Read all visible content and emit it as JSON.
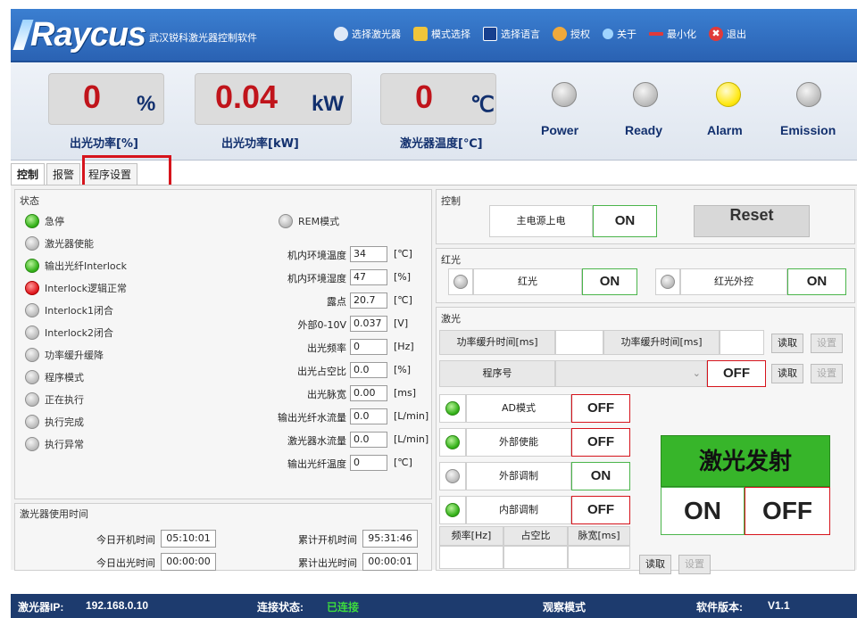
{
  "app": {
    "logo": "Raycus",
    "title": "武汉锐科激光器控制软件",
    "menu": [
      {
        "label": "选择激光器",
        "icon": "laser-select-icon",
        "color": "#ffffff"
      },
      {
        "label": "模式选择",
        "icon": "mode-select-icon",
        "color": "#f0c53b"
      },
      {
        "label": "选择语言",
        "icon": "language-icon",
        "color": "#1e4fa8"
      },
      {
        "label": "授权",
        "icon": "authorize-icon",
        "color": "#f0a93b"
      },
      {
        "label": "关于",
        "icon": "about-icon",
        "color": "#9fd4ff"
      },
      {
        "label": "最小化",
        "icon": "minimize-icon",
        "color": "#e03a3a"
      },
      {
        "label": "退出",
        "icon": "exit-icon",
        "color": "#e03a3a"
      }
    ]
  },
  "readouts": [
    {
      "value": "0",
      "unit": "%",
      "label": "出光功率[%]"
    },
    {
      "value": "0.04",
      "unit": "kW",
      "label": "出光功率[kW]"
    },
    {
      "value": "0",
      "unit": "℃",
      "label": "激光器温度[℃]"
    }
  ],
  "lamps": [
    {
      "label": "Power",
      "on": false
    },
    {
      "label": "Ready",
      "on": false
    },
    {
      "label": "Alarm",
      "on": true
    },
    {
      "label": "Emission",
      "on": false
    }
  ],
  "tabs": [
    "控制",
    "报警",
    "程序设置"
  ],
  "status": {
    "title": "状态",
    "items": [
      {
        "label": "急停",
        "state": "green"
      },
      {
        "label": "激光器使能",
        "state": "grey"
      },
      {
        "label": "输出光纤Interlock",
        "state": "green"
      },
      {
        "label": "Interlock逻辑正常",
        "state": "red"
      },
      {
        "label": "Interlock1闭合",
        "state": "grey"
      },
      {
        "label": "Interlock2闭合",
        "state": "grey"
      },
      {
        "label": "功率缓升缓降",
        "state": "grey"
      },
      {
        "label": "程序模式",
        "state": "grey"
      },
      {
        "label": "正在执行",
        "state": "grey"
      },
      {
        "label": "执行完成",
        "state": "grey"
      },
      {
        "label": "执行异常",
        "state": "grey"
      }
    ],
    "rem_label": "REM模式",
    "params": [
      {
        "label": "机内环境温度",
        "value": "34",
        "unit": "[℃]"
      },
      {
        "label": "机内环境湿度",
        "value": "47",
        "unit": "[%]"
      },
      {
        "label": "露点",
        "value": "20.7",
        "unit": "[℃]"
      },
      {
        "label": "外部0-10V",
        "value": "0.037",
        "unit": "[V]"
      },
      {
        "label": "出光频率",
        "value": "0",
        "unit": "[Hz]"
      },
      {
        "label": "出光占空比",
        "value": "0.0",
        "unit": "[%]"
      },
      {
        "label": "出光脉宽",
        "value": "0.00",
        "unit": "[ms]"
      },
      {
        "label": "输出光纤水流量",
        "value": "0.0",
        "unit": "[L/min]"
      },
      {
        "label": "激光器水流量",
        "value": "0.0",
        "unit": "[L/min]"
      },
      {
        "label": "输出光纤温度",
        "value": "0",
        "unit": "[℃]"
      }
    ]
  },
  "usage": {
    "title": "激光器使用时间",
    "today_on_label": "今日开机时间",
    "today_on": "05:10:01",
    "total_on_label": "累计开机时间",
    "total_on": "95:31:46",
    "today_emit_label": "今日出光时间",
    "today_emit": "00:00:00",
    "total_emit_label": "累计出光时间",
    "total_emit": "00:00:01"
  },
  "control": {
    "title": "控制",
    "main_power_label": "主电源上电",
    "main_power_state": "ON",
    "reset_label": "Reset"
  },
  "redlight": {
    "title": "红光",
    "red_label": "红光",
    "red_state": "ON",
    "ext_label": "红光外控",
    "ext_state": "ON"
  },
  "laser": {
    "title": "激光",
    "rise_label": "功率缓升时间[ms]",
    "fall_label": "功率缓升时间[ms]",
    "read_label": "读取",
    "set_label": "设置",
    "program_label": "程序号",
    "program_state": "OFF",
    "modes": [
      {
        "label": "AD模式",
        "dot": "green",
        "state": "OFF"
      },
      {
        "label": "外部使能",
        "dot": "green",
        "state": "OFF"
      },
      {
        "label": "外部调制",
        "dot": "grey",
        "state": "ON"
      },
      {
        "label": "内部调制",
        "dot": "green",
        "state": "OFF"
      }
    ],
    "table_headers": [
      "频率[Hz]",
      "占空比",
      "脉宽[ms]"
    ],
    "emit_title": "激光发射",
    "emit_on": "ON",
    "emit_off": "OFF"
  },
  "statusbar": {
    "ip_label": "激光器IP:",
    "ip": "192.168.0.10",
    "conn_label": "连接状态:",
    "conn": "已连接",
    "mode": "观察模式",
    "version_label": "软件版本:",
    "version": "V1.1"
  }
}
